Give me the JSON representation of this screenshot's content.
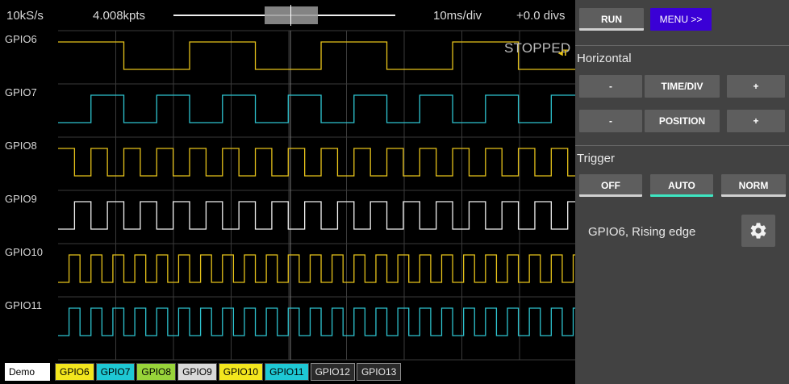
{
  "topbar": {
    "sample_rate": "10kS/s",
    "points": "4.008kpts",
    "time_per_div": "10ms/div",
    "offset": "+0.0 divs"
  },
  "status": "STOPPED",
  "trigger_marker": "T",
  "channels": [
    {
      "label": "GPIO6",
      "color": "#e6c21a",
      "period_divs": 2.28,
      "start_high": true
    },
    {
      "label": "GPIO7",
      "color": "#2ec4d0",
      "period_divs": 1.14,
      "start_high": false
    },
    {
      "label": "GPIO8",
      "color": "#e6c21a",
      "period_divs": 0.57,
      "start_high": true
    },
    {
      "label": "GPIO9",
      "color": "#f0f0f0",
      "period_divs": 0.57,
      "start_high": false
    },
    {
      "label": "GPIO10",
      "color": "#e6c21a",
      "period_divs": 0.38,
      "start_high": false
    },
    {
      "label": "GPIO11",
      "color": "#2ec4d0",
      "period_divs": 0.38,
      "start_high": false
    }
  ],
  "chips": [
    {
      "label": "Demo",
      "bg": "#ffffff",
      "fg": "#000000"
    },
    {
      "label": "GPIO6",
      "bg": "#f3e61e",
      "fg": "#000000"
    },
    {
      "label": "GPIO7",
      "bg": "#1ec8d4",
      "fg": "#000000"
    },
    {
      "label": "GPIO8",
      "bg": "#98d43a",
      "fg": "#000000"
    },
    {
      "label": "GPIO9",
      "bg": "#d9d9d9",
      "fg": "#000000"
    },
    {
      "label": "GPIO10",
      "bg": "#f3e61e",
      "fg": "#000000"
    },
    {
      "label": "GPIO11",
      "bg": "#1ec8d4",
      "fg": "#000000"
    },
    {
      "label": "GPIO12",
      "bg": "#2a2a2a",
      "fg": "#e6e6e6"
    },
    {
      "label": "GPIO13",
      "bg": "#2a2a2a",
      "fg": "#e6e6e6"
    }
  ],
  "panel": {
    "run_label": "RUN",
    "menu_label": "MENU >>",
    "horizontal_title": "Horizontal",
    "minus": "-",
    "plus": "+",
    "timediv_label": "TIME/DIV",
    "position_label": "POSITION",
    "trigger_title": "Trigger",
    "off_label": "OFF",
    "auto_label": "AUTO",
    "norm_label": "NORM",
    "trigger_description": "GPIO6, Rising edge",
    "active_trigger_mode": "AUTO",
    "gear_icon": "gear-icon"
  },
  "colors": {
    "menu_accent": "#3a00d6",
    "active_underline": "#3ee6c2",
    "panel_bg": "#424242"
  }
}
